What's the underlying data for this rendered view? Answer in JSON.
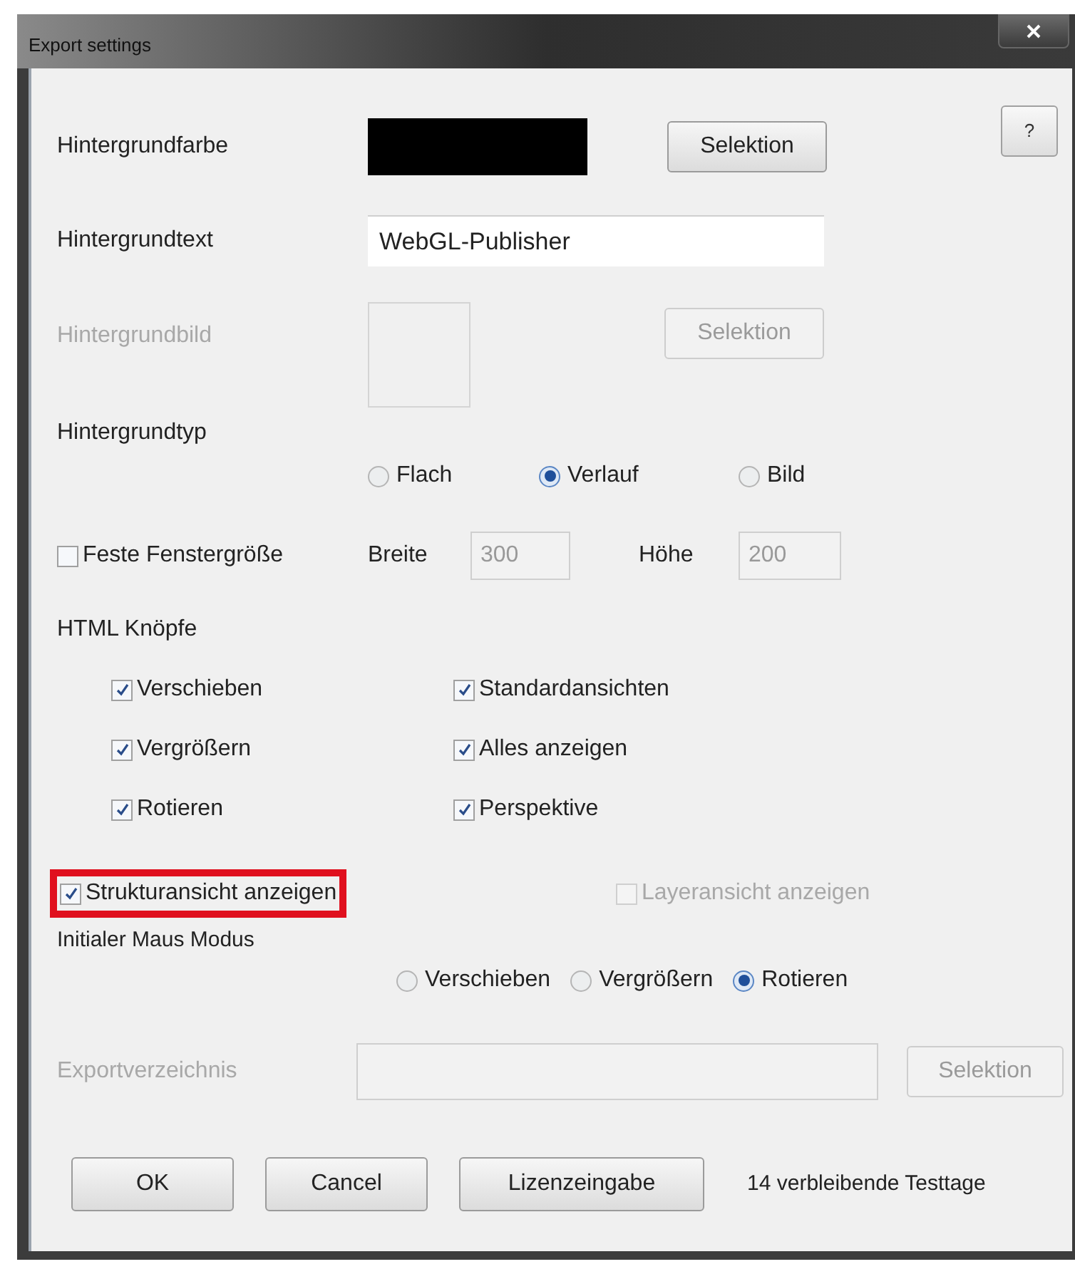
{
  "window": {
    "title": "Export settings"
  },
  "help_button": "?",
  "background_color": {
    "label": "Hintergrundfarbe",
    "color": "#000000",
    "button": "Selektion"
  },
  "background_text": {
    "label": "Hintergrundtext",
    "value": "WebGL-Publisher"
  },
  "background_image": {
    "label": "Hintergrundbild",
    "button": "Selektion",
    "disabled": true
  },
  "background_type": {
    "label": "Hintergrundtyp",
    "options": [
      {
        "label": "Flach",
        "selected": false
      },
      {
        "label": "Verlauf",
        "selected": true
      },
      {
        "label": "Bild",
        "selected": false
      }
    ]
  },
  "fixed_size": {
    "label": "Feste Fenstergröße",
    "checked": false,
    "width_label": "Breite",
    "width_value": "300",
    "height_label": "Höhe",
    "height_value": "200"
  },
  "html_buttons": {
    "label": "HTML Knöpfe",
    "items": [
      {
        "label": "Verschieben",
        "checked": true
      },
      {
        "label": "Standardansichten",
        "checked": true
      },
      {
        "label": "Vergrößern",
        "checked": true
      },
      {
        "label": "Alles anzeigen",
        "checked": true
      },
      {
        "label": "Rotieren",
        "checked": true
      },
      {
        "label": "Perspektive",
        "checked": true
      }
    ]
  },
  "tree_view": {
    "label": "Strukturansicht anzeigen",
    "checked": true,
    "highlighted": true
  },
  "layer_view": {
    "label": "Layeransicht anzeigen",
    "checked": false,
    "disabled": true
  },
  "mouse_mode": {
    "label": "Initialer Maus Modus",
    "options": [
      {
        "label": "Verschieben",
        "selected": false
      },
      {
        "label": "Vergrößern",
        "selected": false
      },
      {
        "label": "Rotieren",
        "selected": true
      }
    ]
  },
  "export_dir": {
    "label": "Exportverzeichnis",
    "button": "Selektion",
    "disabled": true
  },
  "buttons": [
    "OK",
    "Cancel",
    "Lizenzeingabe"
  ],
  "trial_note": "14 verbleibende Testtage"
}
